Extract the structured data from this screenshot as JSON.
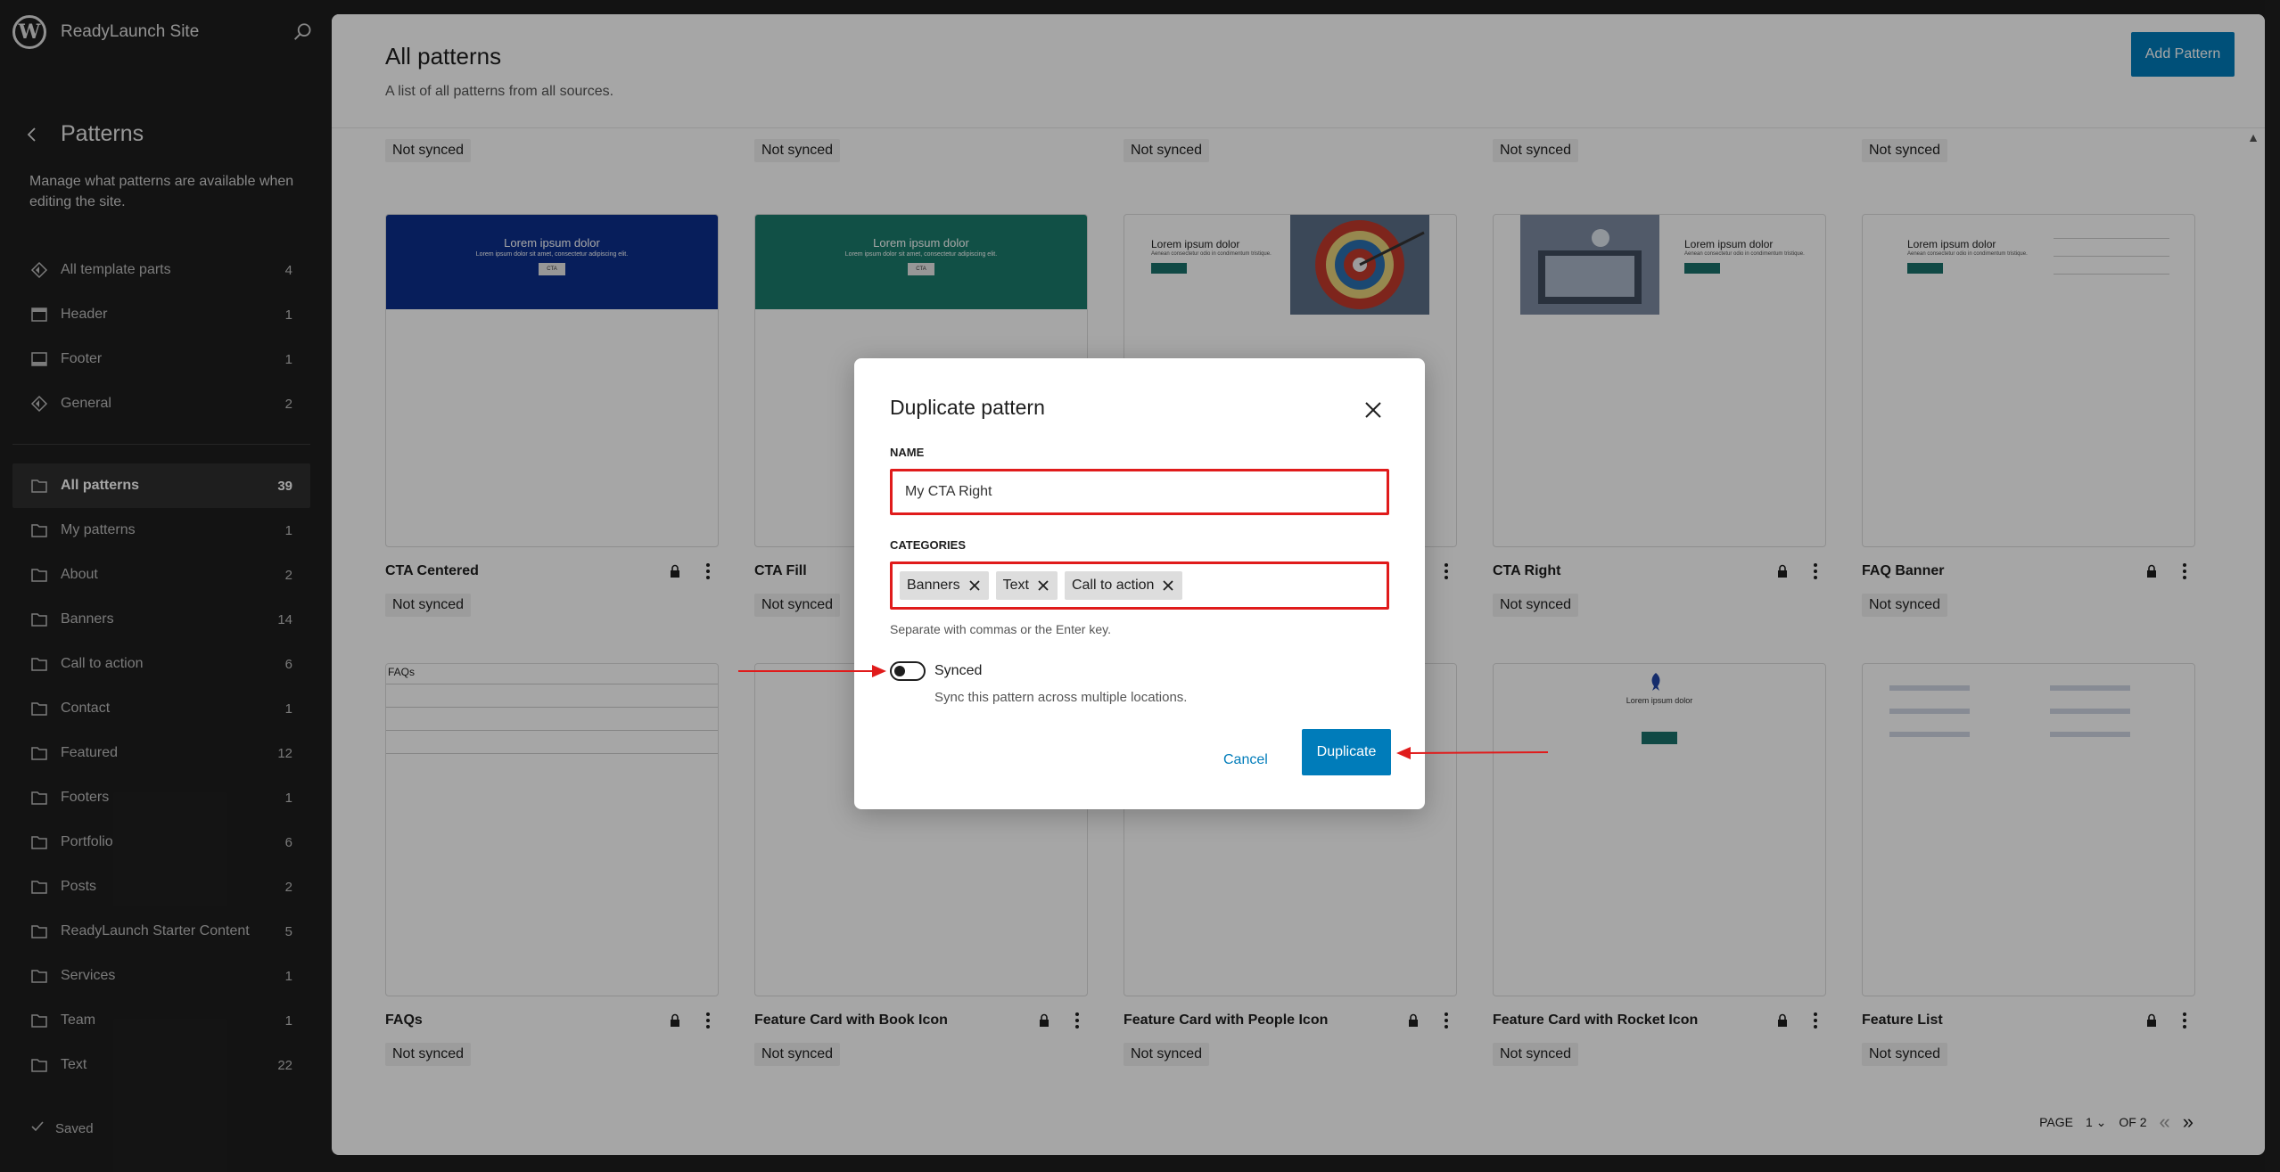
{
  "site": {
    "name": "ReadyLaunch Site"
  },
  "nav": {
    "title": "Patterns",
    "description": "Manage what patterns are available when editing the site.",
    "template_parts": [
      {
        "label": "All template parts",
        "count": "4",
        "icon": "diamond-icon"
      },
      {
        "label": "Header",
        "count": "1",
        "icon": "header-icon"
      },
      {
        "label": "Footer",
        "count": "1",
        "icon": "footer-icon"
      },
      {
        "label": "General",
        "count": "2",
        "icon": "diamond-icon"
      }
    ],
    "categories": [
      {
        "label": "All patterns",
        "count": "39",
        "active": true
      },
      {
        "label": "My patterns",
        "count": "1"
      },
      {
        "label": "About",
        "count": "2"
      },
      {
        "label": "Banners",
        "count": "14"
      },
      {
        "label": "Call to action",
        "count": "6"
      },
      {
        "label": "Contact",
        "count": "1"
      },
      {
        "label": "Featured",
        "count": "12"
      },
      {
        "label": "Footers",
        "count": "1"
      },
      {
        "label": "Portfolio",
        "count": "6"
      },
      {
        "label": "Posts",
        "count": "2"
      },
      {
        "label": "ReadyLaunch Starter Content",
        "count": "5"
      },
      {
        "label": "Services",
        "count": "1"
      },
      {
        "label": "Team",
        "count": "1"
      },
      {
        "label": "Text",
        "count": "22"
      }
    ],
    "saved_label": "Saved"
  },
  "header": {
    "title": "All patterns",
    "subtitle": "A list of all patterns from all sources.",
    "add_button": "Add Pattern"
  },
  "top_statuses": [
    "Not synced",
    "Not synced",
    "Not synced",
    "Not synced",
    "Not synced"
  ],
  "patterns_row1": [
    {
      "title": "CTA Centered",
      "status": "Not synced",
      "thumb_text": "Lorem ipsum dolor",
      "thumb_sub": "Lorem ipsum dolor sit amet, consectetur adipiscing elit.",
      "thumb_btn": "CTA",
      "bg": "#0b2f8c"
    },
    {
      "title": "CTA Fill",
      "status": "Not synced",
      "thumb_text": "Lorem ipsum dolor",
      "thumb_sub": "Lorem ipsum dolor sit amet, consectetur adipiscing elit.",
      "thumb_btn": "CTA",
      "bg": "#1b7c6c"
    },
    {
      "title": "",
      "status": "",
      "thumb_text": "Lorem ipsum dolor",
      "thumb_sub": "Aenean consectetur odio in condimentum tristique."
    },
    {
      "title": "CTA Right",
      "status": "Not synced",
      "thumb_text": "Lorem ipsum dolor",
      "thumb_sub": "Aenean consectetur odio in condimentum tristique."
    },
    {
      "title": "FAQ Banner",
      "status": "Not synced",
      "thumb_text": "Lorem ipsum dolor",
      "thumb_sub": "Aenean consectetur odio in condimentum tristique."
    }
  ],
  "patterns_row2": [
    {
      "title": "FAQs",
      "status": "Not synced",
      "thumb_text": "FAQs"
    },
    {
      "title": "Feature Card with Book Icon",
      "status": "Not synced"
    },
    {
      "title": "Feature Card with People Icon",
      "status": "Not synced"
    },
    {
      "title": "Feature Card with Rocket Icon",
      "status": "Not synced",
      "thumb_text": "Lorem ipsum dolor"
    },
    {
      "title": "Feature List",
      "status": "Not synced"
    }
  ],
  "pagination": {
    "page_label": "PAGE",
    "current": "1",
    "of_label": "OF 2"
  },
  "modal": {
    "title": "Duplicate pattern",
    "name_label": "NAME",
    "name_value": "My CTA Right",
    "categories_label": "CATEGORIES",
    "categories": [
      "Banners",
      "Text",
      "Call to action"
    ],
    "categories_help": "Separate with commas or the Enter key.",
    "synced_label": "Synced",
    "synced_on": false,
    "synced_help": "Sync this pattern across multiple locations.",
    "cancel": "Cancel",
    "duplicate": "Duplicate"
  },
  "colors": {
    "accent": "#007cba",
    "highlight": "#e01b1b"
  }
}
